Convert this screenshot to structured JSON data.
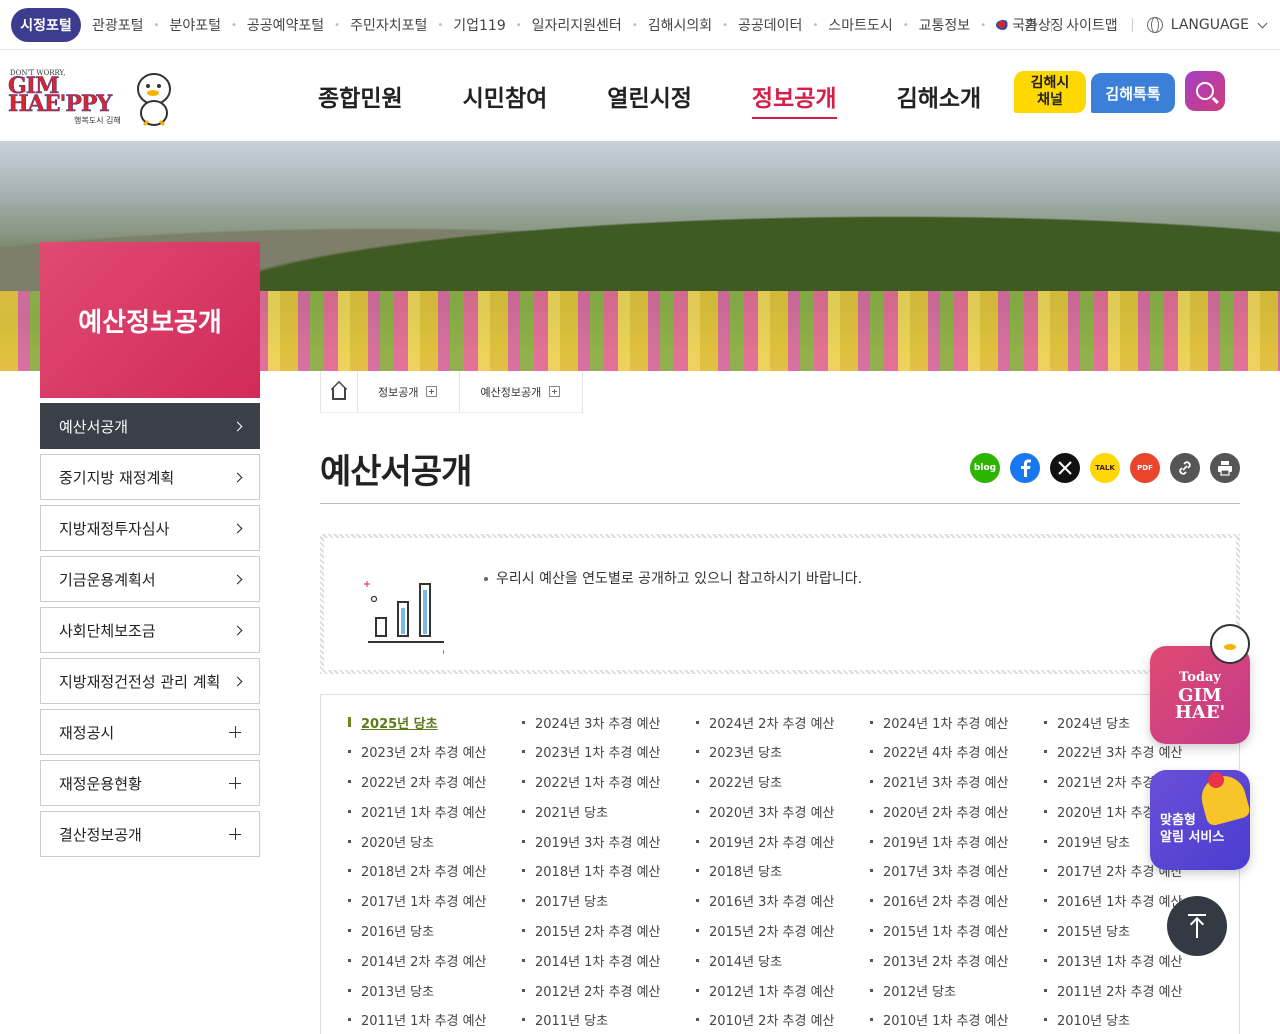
{
  "topbar": {
    "portal": "시정포털",
    "links": [
      "관광포털",
      "분야포털",
      "공공예약포털",
      "주민자치포털",
      "기업119",
      "일자리지원센터",
      "김해시의회",
      "공공데이터",
      "스마트도시",
      "교통정보",
      "국가상징"
    ],
    "home": "홈",
    "sitemap": "사이트맵",
    "language": "LANGUAGE"
  },
  "logo": {
    "small": "DON'T WORRY,",
    "big1": "GIM",
    "big2": "HAE'PPY",
    "sub": "행복도시 김해"
  },
  "nav": [
    "종합민원",
    "시민참여",
    "열린시정",
    "정보공개",
    "김해소개"
  ],
  "header": {
    "channel_line1": "김해시",
    "channel_line2": "채널",
    "talk": "김해톡톡"
  },
  "side": {
    "title": "예산정보공개",
    "menu": [
      {
        "label": "예산서공개",
        "type": "arrow"
      },
      {
        "label": "중기지방 재정계획",
        "type": "arrow"
      },
      {
        "label": "지방재정투자심사",
        "type": "arrow"
      },
      {
        "label": "기금운용계획서",
        "type": "arrow"
      },
      {
        "label": "사회단체보조금",
        "type": "arrow"
      },
      {
        "label": "지방재정건전성 관리 계획",
        "type": "arrow"
      },
      {
        "label": "재정공시",
        "type": "plus"
      },
      {
        "label": "재정운용현황",
        "type": "plus"
      },
      {
        "label": "결산정보공개",
        "type": "plus"
      }
    ]
  },
  "breadcrumb": [
    "정보공개",
    "예산정보공개"
  ],
  "page_title": "예산서공개",
  "share": {
    "blog": "blog",
    "talk": "TALK",
    "pdf": "PDF",
    "colors": {
      "blog": "#2db400",
      "facebook": "#1877f2",
      "x": "#111111",
      "kakao": "#ffd800",
      "pdf": "#e8452c",
      "link": "#555555",
      "print": "#555555"
    }
  },
  "notice": "우리시 예산을 연도별로 공개하고 있으니 참고하시기 바랍니다.",
  "budget_list": [
    "2025년 당초",
    "2024년 3차 추경 예산",
    "2024년 2차 추경 예산",
    "2024년 1차 추경 예산",
    "2024년 당초",
    "2023년 2차 추경 예산",
    "2023년 1차 추경 예산",
    "2023년 당초",
    "2022년 4차 추경 예산",
    "2022년 3차 추경 예산",
    "2022년 2차 추경 예산",
    "2022년 1차 추경 예산",
    "2022년 당초",
    "2021년 3차 추경 예산",
    "2021년 2차 추경 예산",
    "2021년 1차 추경 예산",
    "2021년 당초",
    "2020년 3차 추경 예산",
    "2020년 2차 추경 예산",
    "2020년 1차 추경 예산",
    "2020년 당초",
    "2019년 3차 추경 예산",
    "2019년 2차 추경 예산",
    "2019년 1차 추경 예산",
    "2019년 당초",
    "2018년 2차 추경 예산",
    "2018년 1차 추경 예산",
    "2018년 당초",
    "2017년 3차 추경 예산",
    "2017년 2차 추경 예산",
    "2017년 1차 추경 예산",
    "2017년 당초",
    "2016년 3차 추경 예산",
    "2016년 2차 추경 예산",
    "2016년 1차 추경 예산",
    "2016년 당초",
    "2015년 2차 추경 예산",
    "2015년 2차 추경 예산",
    "2015년 1차 추경 예산",
    "2015년 당초",
    "2014년 2차 추경 예산",
    "2014년 1차 추경 예산",
    "2014년 당초",
    "2013년 2차 추경 예산",
    "2013년 1차 추경 예산",
    "2013년 당초",
    "2012년 2차 추경 예산",
    "2012년 1차 추경 예산",
    "2012년 당초",
    "2011년 2차 추경 예산",
    "2011년 1차 추경 예산",
    "2011년 당초",
    "2010년 2차 추경 예산",
    "2010년 1차 추경 예산",
    "2010년 당초"
  ],
  "floating": {
    "today_line1": "Today",
    "today_line2": "GIM",
    "today_line3": "HAE'",
    "alarm_line1": "맞춤형",
    "alarm_line2": "알림 서비스"
  }
}
